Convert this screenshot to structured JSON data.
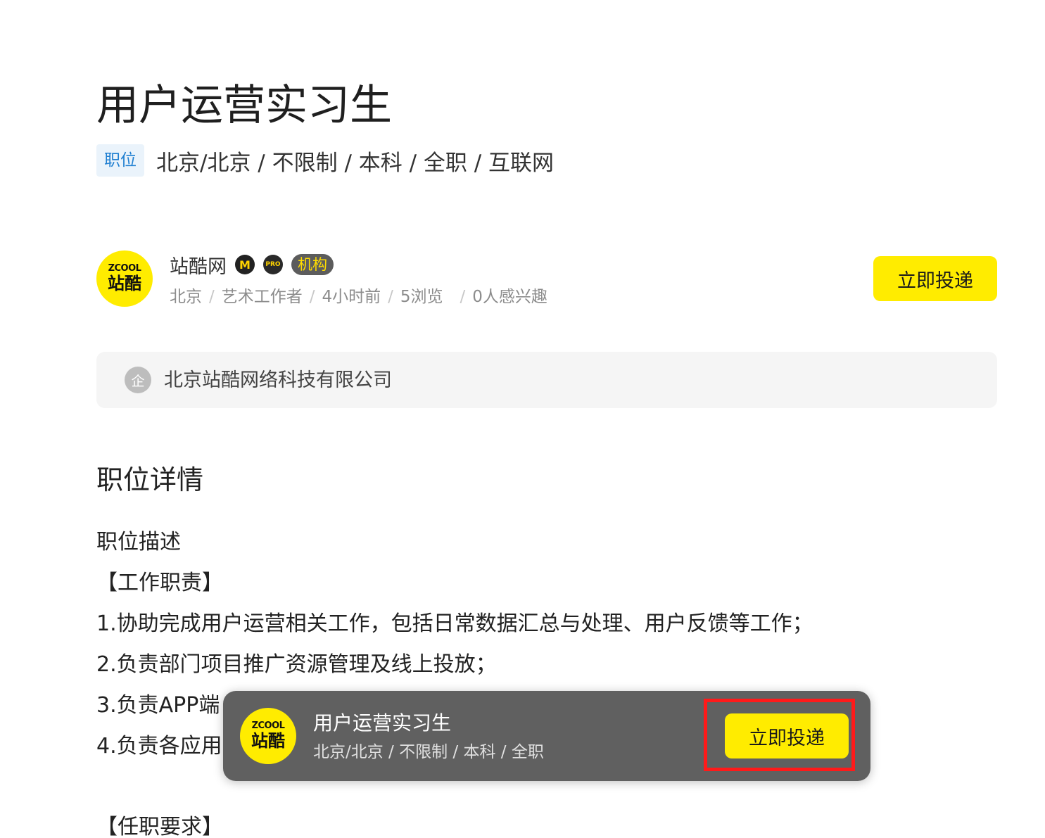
{
  "job": {
    "title": "用户运营实习生",
    "tag": "职位",
    "meta": "北京/北京 / 不限制 / 本科 / 全职 / 互联网"
  },
  "company": {
    "logo_en": "ZCOOL",
    "logo_cn": "站酷",
    "name": "站酷网",
    "badge_m": "M",
    "badge_pro": "PRO",
    "badge_org": "机构",
    "meta": [
      "北京",
      "艺术工作者",
      "4小时前",
      "5浏览",
      "0人感兴趣"
    ],
    "apply_label": "立即投递"
  },
  "enterprise": {
    "icon_char": "企",
    "name": "北京站酷网络科技有限公司"
  },
  "details": {
    "section_title": "职位详情",
    "lines": [
      "职位描述",
      "【工作职责】",
      "1.协助完成用户运营相关工作，包括日常数据汇总与处理、用户反馈等工作；",
      "2.负责部门项目推广资源管理及线上投放；",
      "3.负责APP端",
      "4.负责各应用",
      "【任职要求】"
    ]
  },
  "sticky": {
    "logo_en": "ZCOOL",
    "logo_cn": "站酷",
    "title": "用户运营实习生",
    "meta": "北京/北京 / 不限制 / 本科 / 全职",
    "apply_label": "立即投递"
  },
  "colors": {
    "accent": "#ffec00",
    "highlight": "#ff1a1a",
    "tag_bg": "#eaf3fb",
    "tag_text": "#1f7fd1"
  }
}
